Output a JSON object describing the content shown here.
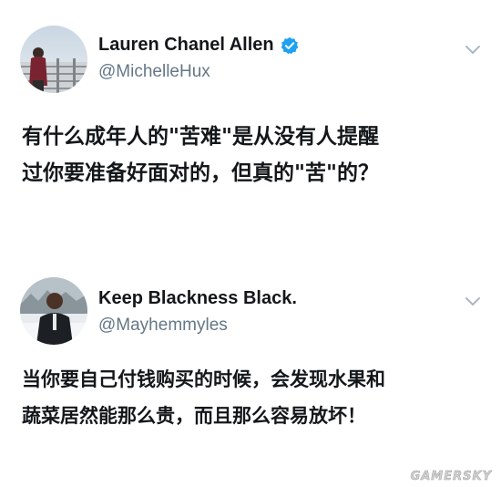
{
  "tweets": [
    {
      "display_name": "Lauren Chanel Allen",
      "handle": "@MichelleHux",
      "verified": true,
      "text_lines": [
        "有什么成年人的\"苦难\"是从没有人提醒",
        "过你要准备好面对的，但真的\"苦\"的？"
      ],
      "avatar_icon": "profile-photo",
      "menu_icon": "chevron-down-icon"
    },
    {
      "display_name": "Keep Blackness Black.",
      "handle": "@Mayhemmyles",
      "verified": false,
      "text_lines": [
        "当你要自己付钱购买的时候，会发现水果和",
        "蔬菜居然能那么贵，而且那么容易放坏！"
      ],
      "avatar_icon": "profile-photo",
      "menu_icon": "chevron-down-icon"
    }
  ],
  "watermark": "GAMERSKY",
  "colors": {
    "text": "#14171a",
    "handle": "#657786",
    "verified": "#1da1f2",
    "chevron": "#aab8c2"
  }
}
